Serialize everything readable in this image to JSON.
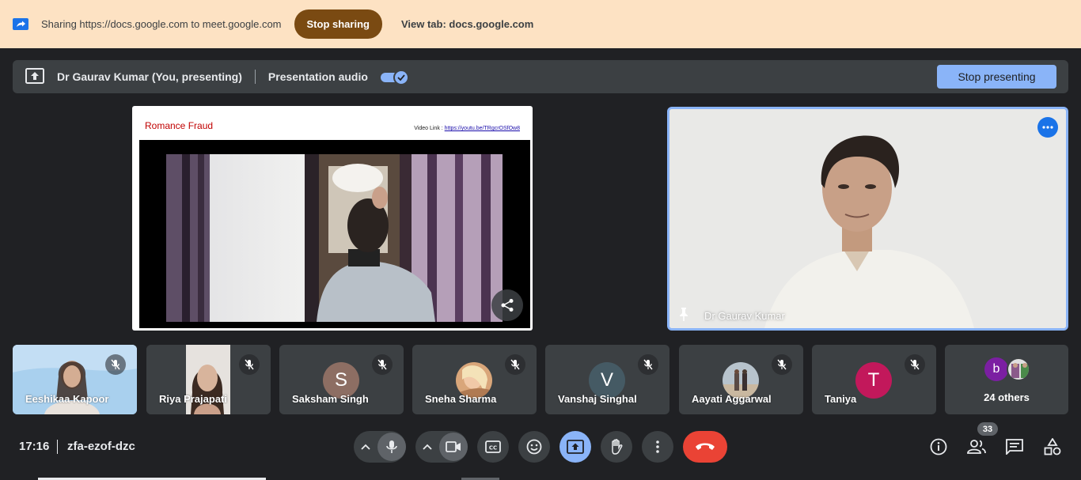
{
  "share_bar": {
    "text": "Sharing https://docs.google.com to meet.google.com",
    "stop_sharing": "Stop sharing",
    "view_tab": "View tab: docs.google.com"
  },
  "present_bar": {
    "presenter": "Dr Gaurav Kumar (You, presenting)",
    "audio_label": "Presentation audio",
    "audio_on": true,
    "stop_presenting": "Stop presenting"
  },
  "slide": {
    "title": "Romance Fraud",
    "link_label": "Video Link :",
    "link_url": "https://youtu.be/TRgcrOSfOw8"
  },
  "speaker": {
    "name": "Dr Gaurav Kumar"
  },
  "participants": [
    {
      "name": "Eeshikaa Kapoor",
      "kind": "video"
    },
    {
      "name": "Riya Prajapati",
      "kind": "video"
    },
    {
      "name": "Saksham Singh",
      "kind": "letter",
      "letter": "S",
      "color": "#8d6e63"
    },
    {
      "name": "Sneha Sharma",
      "kind": "photo"
    },
    {
      "name": "Vanshaj Singhal",
      "kind": "letter",
      "letter": "V",
      "color": "#455a64"
    },
    {
      "name": "Aayati Aggarwal",
      "kind": "photo"
    },
    {
      "name": "Taniya",
      "kind": "letter",
      "letter": "T",
      "color": "#c2185b"
    }
  ],
  "others": {
    "letter": "b",
    "color": "#7b1fa2",
    "label": "24 others"
  },
  "bottom": {
    "time": "17:16",
    "meeting_code": "zfa-ezof-dzc",
    "people_count": "33"
  },
  "colors": {
    "accent": "#8ab4f8",
    "end_call": "#ea4335",
    "banner": "#fde2c3"
  }
}
